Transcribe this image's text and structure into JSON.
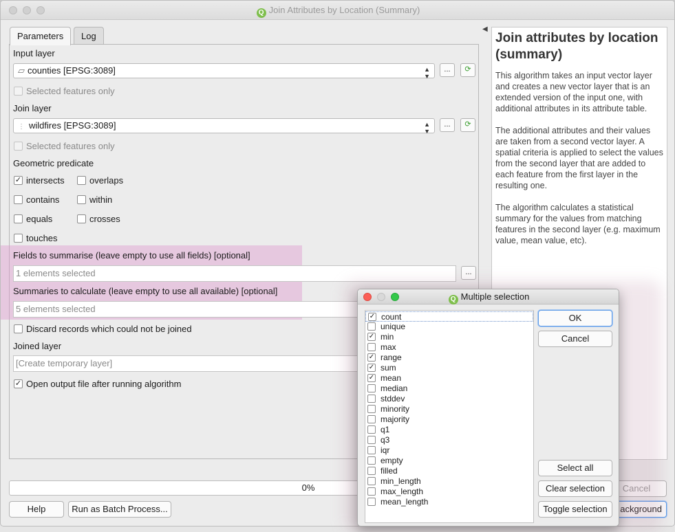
{
  "window": {
    "title": "Join Attributes by Location (Summary)",
    "app_icon": "qgis-icon"
  },
  "tabs": [
    {
      "label": "Parameters",
      "active": true
    },
    {
      "label": "Log",
      "active": false
    }
  ],
  "params": {
    "input_layer_label": "Input layer",
    "input_layer_value": "counties [EPSG:3089]",
    "selected_only_1": "Selected features only",
    "join_layer_label": "Join layer",
    "join_layer_value": "wildfires [EPSG:3089]",
    "selected_only_2": "Selected features only",
    "predicate_label": "Geometric predicate",
    "predicates": [
      {
        "label": "intersects",
        "checked": true
      },
      {
        "label": "overlaps",
        "checked": false
      },
      {
        "label": "contains",
        "checked": false
      },
      {
        "label": "within",
        "checked": false
      },
      {
        "label": "equals",
        "checked": false
      },
      {
        "label": "crosses",
        "checked": false
      },
      {
        "label": "touches",
        "checked": false
      }
    ],
    "fields_label": "Fields to summarise (leave empty to use all fields) [optional]",
    "fields_value": "1 elements selected",
    "summaries_label": "Summaries to calculate (leave empty to use all available) [optional]",
    "summaries_value": "5 elements selected",
    "discard_label": "Discard records which could not be joined",
    "discard_checked": false,
    "joined_label": "Joined layer",
    "joined_value": "[Create temporary layer]",
    "open_output_label": "Open output file after running algorithm",
    "open_output_checked": true,
    "ellipsis": "..."
  },
  "help": {
    "title": "Join attributes by location (summary)",
    "paragraphs": [
      "This algorithm takes an input vector layer and creates a new vector layer that is an extended version of the input one, with additional attributes in its attribute table.",
      "The additional attributes and their values are taken from a second vector layer. A spatial criteria is applied to select the values from the second layer that are added to each feature from the first layer in the resulting one.",
      "The algorithm calculates a statistical summary for the values from matching features in the second layer (e.g. maximum value, mean value, etc)."
    ]
  },
  "progress": {
    "text": "0%",
    "value": 0
  },
  "bottom_buttons": {
    "help": "Help",
    "batch": "Run as Batch Process...",
    "cancel": "Cancel",
    "background": "ackground"
  },
  "dialog": {
    "title": "Multiple selection",
    "items": [
      {
        "label": "count",
        "checked": true
      },
      {
        "label": "unique",
        "checked": false
      },
      {
        "label": "min",
        "checked": true
      },
      {
        "label": "max",
        "checked": false
      },
      {
        "label": "range",
        "checked": true
      },
      {
        "label": "sum",
        "checked": true
      },
      {
        "label": "mean",
        "checked": true
      },
      {
        "label": "median",
        "checked": false
      },
      {
        "label": "stddev",
        "checked": false
      },
      {
        "label": "minority",
        "checked": false
      },
      {
        "label": "majority",
        "checked": false
      },
      {
        "label": "q1",
        "checked": false
      },
      {
        "label": "q3",
        "checked": false
      },
      {
        "label": "iqr",
        "checked": false
      },
      {
        "label": "empty",
        "checked": false
      },
      {
        "label": "filled",
        "checked": false
      },
      {
        "label": "min_length",
        "checked": false
      },
      {
        "label": "max_length",
        "checked": false
      },
      {
        "label": "mean_length",
        "checked": false
      }
    ],
    "ok": "OK",
    "cancel": "Cancel",
    "select_all": "Select all",
    "clear_selection": "Clear selection",
    "toggle_selection": "Toggle selection"
  },
  "colors": {
    "highlight": "#de96cd",
    "mac_close": "#fc5f57",
    "mac_min": "#d9d9d9",
    "mac_max": "#34c84a",
    "focus": "#5d9be6"
  }
}
